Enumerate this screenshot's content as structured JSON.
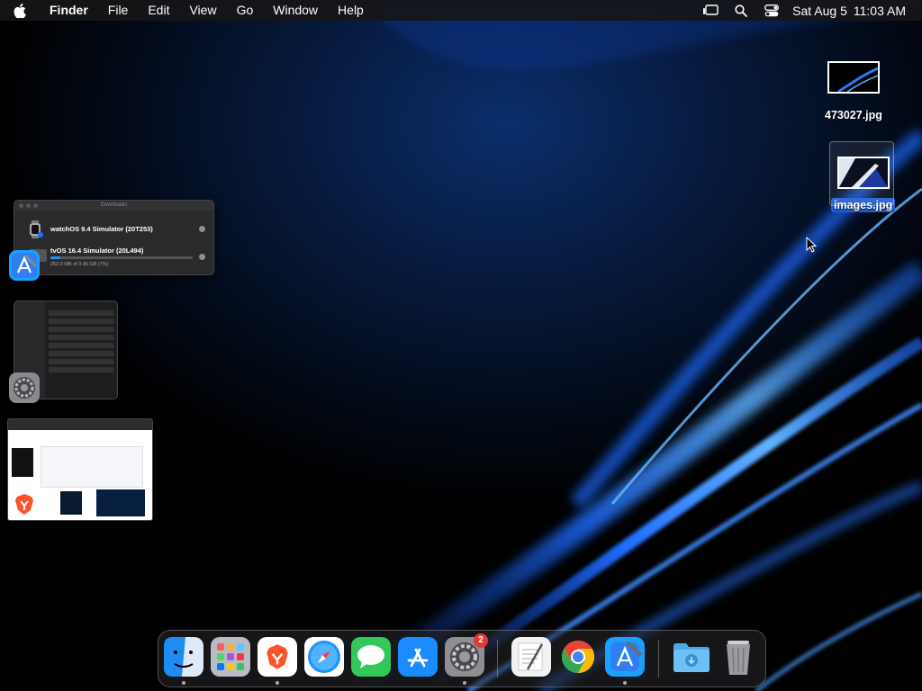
{
  "menubar": {
    "apple_icon": "apple-logo-icon",
    "app_name": "Finder",
    "menus": [
      "File",
      "Edit",
      "View",
      "Go",
      "Window",
      "Help"
    ],
    "status_icons": [
      "stage-manager-icon",
      "spotlight-search-icon",
      "control-center-icon"
    ],
    "date": "Sat Aug 5",
    "time": "11:03 AM"
  },
  "desktop": {
    "icons": [
      {
        "label": "473027.jpg",
        "selected": false
      },
      {
        "label": "images.jpg",
        "selected": true
      }
    ]
  },
  "stage_manager": {
    "xcode_window": {
      "title": "Downloads",
      "items": [
        {
          "name": "watchOS 9.4 Simulator (20T253)"
        },
        {
          "name": "tvOS 16.4 Simulator (20L494)",
          "progress_text": "252.0 MB of 3.46 GB (7%)",
          "progress": 0.07
        }
      ]
    },
    "groups": [
      "Xcode",
      "System Settings",
      "Brave Browser"
    ]
  },
  "dock": {
    "apps": [
      {
        "name": "Finder",
        "icon": "finder-icon",
        "running": true
      },
      {
        "name": "Launchpad",
        "icon": "launchpad-icon",
        "running": false
      },
      {
        "name": "Brave Browser",
        "icon": "brave-icon",
        "running": true
      },
      {
        "name": "Safari",
        "icon": "safari-icon",
        "running": false
      },
      {
        "name": "Messages",
        "icon": "messages-icon",
        "running": false
      },
      {
        "name": "App Store",
        "icon": "app-store-icon",
        "running": false
      },
      {
        "name": "System Settings",
        "icon": "settings-icon",
        "running": true,
        "badge": "2"
      },
      {
        "name": "TextEdit",
        "icon": "textedit-icon",
        "running": false
      },
      {
        "name": "Google Chrome",
        "icon": "chrome-icon",
        "running": false
      },
      {
        "name": "Xcode",
        "icon": "xcode-icon",
        "running": true
      },
      {
        "name": "Downloads",
        "icon": "downloads-folder-icon",
        "running": false
      },
      {
        "name": "Trash",
        "icon": "trash-icon",
        "running": false
      }
    ]
  },
  "colors": {
    "wallpaper_glow": "#1e6bff",
    "selection": "#1f5fd6",
    "badge": "#e53935"
  }
}
